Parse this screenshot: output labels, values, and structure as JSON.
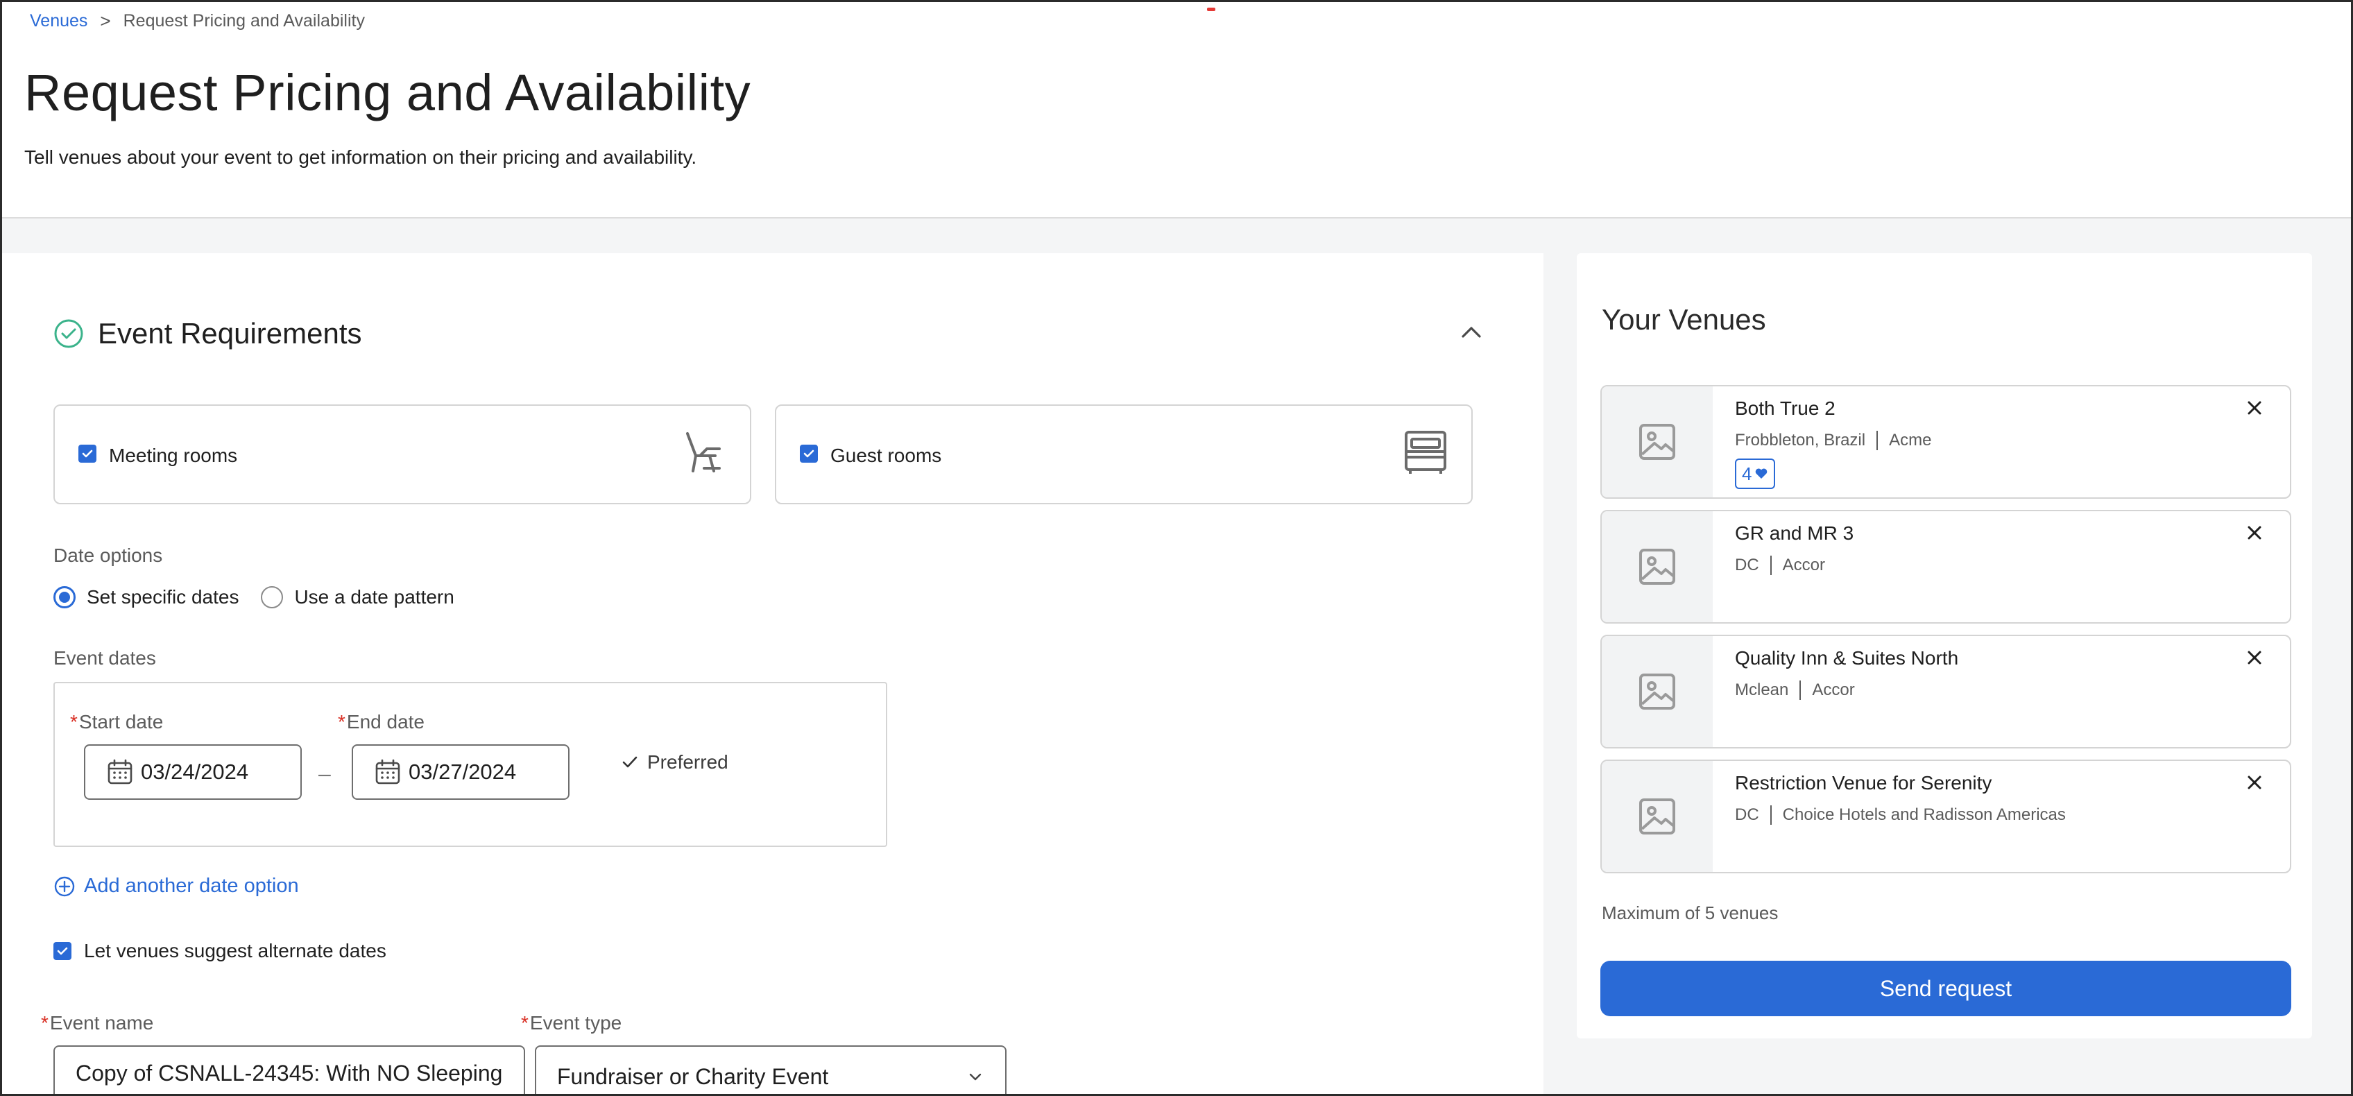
{
  "breadcrumb": {
    "link": "Venues",
    "separator": ">",
    "current": "Request Pricing and Availability"
  },
  "header": {
    "title": "Request Pricing and Availability",
    "subtitle": "Tell venues about your event to get information on their pricing and availability."
  },
  "requirements": {
    "title": "Event Requirements",
    "room_types": [
      {
        "label": "Meeting rooms",
        "checked": true,
        "icon": "chair-icon"
      },
      {
        "label": "Guest rooms",
        "checked": true,
        "icon": "bed-icon"
      }
    ],
    "date_options": {
      "label": "Date options",
      "options": [
        "Set specific dates",
        "Use a date pattern"
      ],
      "selected": "Set specific dates"
    },
    "event_dates": {
      "label": "Event dates",
      "start_label": "Start date",
      "end_label": "End date",
      "required_mark": "*",
      "dash": "–",
      "start_value": "03/24/2024",
      "end_value": "03/27/2024",
      "preferred": "Preferred"
    },
    "add_date_option": "Add another date option",
    "suggest_alternate": {
      "label": "Let venues suggest alternate dates",
      "checked": true
    },
    "event_name": {
      "label": "Event name",
      "value": "Copy of CSNALL-24345: With NO Sleeping"
    },
    "event_type": {
      "label": "Event type",
      "value": "Fundraiser or Charity Event"
    }
  },
  "venues_panel": {
    "title": "Your Venues",
    "venues": [
      {
        "name": "Both True 2",
        "location": "Frobbleton, Brazil",
        "brand": "Acme",
        "badge": "4"
      },
      {
        "name": "GR and MR 3",
        "location": "DC",
        "brand": "Accor"
      },
      {
        "name": "Quality Inn & Suites North",
        "location": "Mclean",
        "brand": "Accor"
      },
      {
        "name": "Restriction Venue for Serenity",
        "location": "DC",
        "brand": "Choice Hotels and Radisson Americas"
      }
    ],
    "max_note": "Maximum of 5 venues",
    "send_label": "Send request"
  },
  "colors": {
    "accent": "#2a6ad6",
    "success": "#3bb38b",
    "required": "#d93025",
    "panel_bg": "#f4f5f6"
  }
}
